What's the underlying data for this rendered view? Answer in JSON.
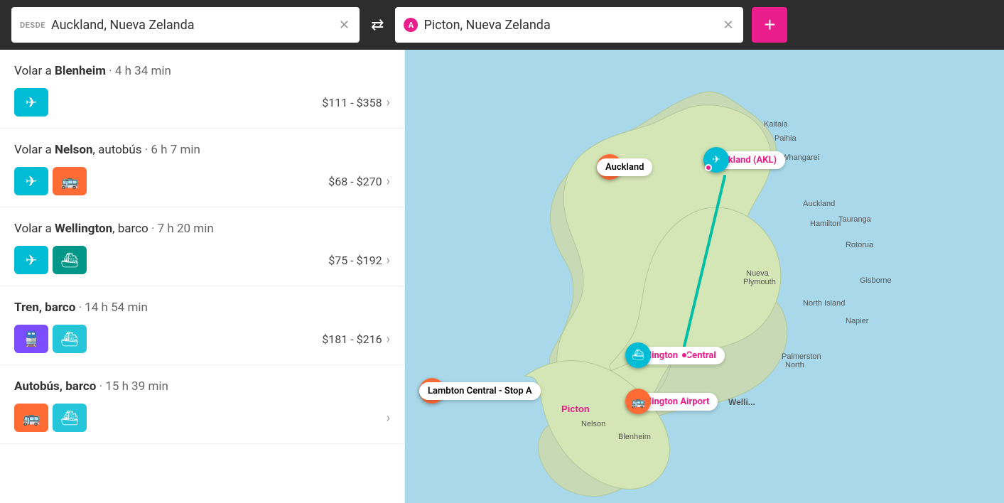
{
  "header": {
    "from_label": "DESDE",
    "from_value": "Auckland, Nueva Zelanda",
    "to_icon": "A",
    "to_value": "Picton, Nueva Zelanda",
    "add_button": "+"
  },
  "routes": [
    {
      "id": 1,
      "title_prefix": "Volar a ",
      "destination": "Blenheim",
      "duration_prefix": " · ",
      "duration": "4 h 34 min",
      "transport": [
        "plane"
      ],
      "price": "$111 - $358",
      "badge_colors": [
        "teal"
      ]
    },
    {
      "id": 2,
      "title_prefix": "Volar a ",
      "destination": "Nelson",
      "extra": ", autobús",
      "duration_prefix": " · ",
      "duration": "6 h 7 min",
      "transport": [
        "plane",
        "bus"
      ],
      "price": "$68 - $270",
      "badge_colors": [
        "teal",
        "orange"
      ]
    },
    {
      "id": 3,
      "title_prefix": "Volar a ",
      "destination": "Wellington",
      "extra": ", barco",
      "duration_prefix": " · ",
      "duration": "7 h 20 min",
      "transport": [
        "plane",
        "ferry"
      ],
      "price": "$75 - $192",
      "badge_colors": [
        "teal",
        "teal-dark"
      ]
    },
    {
      "id": 4,
      "title_prefix": "",
      "destination": "Tren, barco",
      "extra": "",
      "duration_prefix": " · ",
      "duration": "14 h 54 min",
      "transport": [
        "train",
        "ferry"
      ],
      "price": "$181 - $216",
      "badge_colors": [
        "purple",
        "cyan"
      ]
    },
    {
      "id": 5,
      "title_prefix": "",
      "destination": "Autobús, barco",
      "extra": "",
      "duration_prefix": " · ",
      "duration": "15 h 39 min",
      "transport": [
        "bus",
        "ferry"
      ],
      "price": "",
      "badge_colors": [
        "orange",
        "cyan"
      ]
    }
  ],
  "map": {
    "markers": [
      {
        "id": "auckland",
        "label": "Auckland",
        "type": "orange",
        "icon": "🚌"
      },
      {
        "id": "auckland-akl",
        "label": "Auckland (AKL)",
        "type": "teal",
        "icon": "✈"
      },
      {
        "id": "lambton",
        "label": "Lambton Central - Stop A",
        "type": "orange",
        "icon": "🚌"
      },
      {
        "id": "wellington-central",
        "label": "Wellington - Central",
        "type": "teal",
        "icon": "⛴"
      },
      {
        "id": "wellington-airport",
        "label": "Wellington Airport",
        "type": "orange",
        "icon": "🚌"
      },
      {
        "id": "picton",
        "label": "Picton",
        "type": "pink"
      }
    ]
  }
}
